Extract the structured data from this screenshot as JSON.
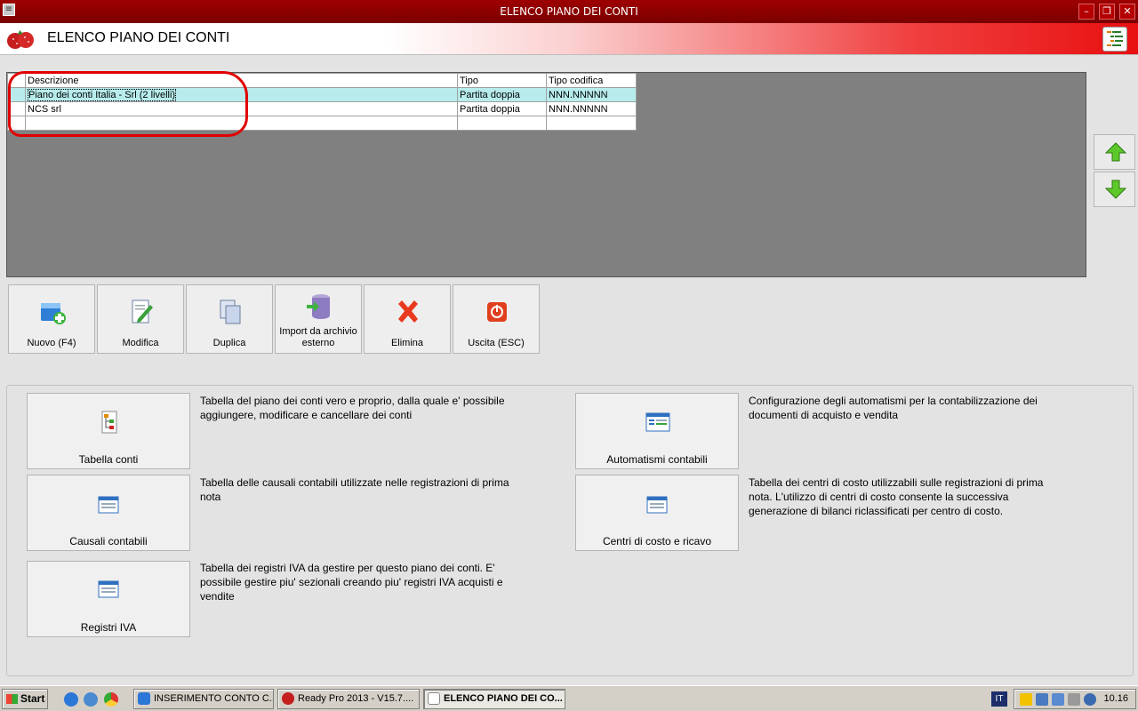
{
  "window": {
    "title": "ELENCO PIANO DEI CONTI"
  },
  "header": {
    "title": "ELENCO PIANO DEI CONTI"
  },
  "grid": {
    "columns": [
      "Descrizione",
      "Tipo",
      "Tipo codifica"
    ],
    "rows": [
      {
        "descrizione": "Piano dei conti Italia - Srl (2 livelli)",
        "tipo": "Partita doppia",
        "codifica": "NNN.NNNNN",
        "selected": true
      },
      {
        "descrizione": "NCS srl",
        "tipo": "Partita doppia",
        "codifica": "NNN.NNNNN",
        "selected": false
      }
    ]
  },
  "toolbar": {
    "nuovo": "Nuovo (F4)",
    "modifica": "Modifica",
    "duplica": "Duplica",
    "import_line1": "Import da archivio",
    "import_line2": "esterno",
    "elimina": "Elimina",
    "uscita": "Uscita (ESC)"
  },
  "options": {
    "tabella_conti": {
      "label": "Tabella conti",
      "desc": "Tabella del piano dei conti vero e proprio, dalla quale e' possibile aggiungere, modificare e cancellare dei conti"
    },
    "causali": {
      "label": "Causali contabili",
      "desc": "Tabella delle causali contabili utilizzate nelle registrazioni di prima nota"
    },
    "registri_iva": {
      "label": "Registri IVA",
      "desc": "Tabella dei registri IVA da gestire per questo piano dei conti. E' possibile gestire piu' sezionali creando piu' registri IVA acquisti e vendite"
    },
    "automatismi": {
      "label": "Automatismi contabili",
      "desc": "Configurazione degli automatismi per la contabilizzazione dei documenti di acquisto e vendita"
    },
    "centri_costo": {
      "label": "Centri di costo e ricavo",
      "desc": "Tabella dei centri di costo utilizzabili sulle registrazioni di prima nota. L'utilizzo di centri di costo consente la successiva generazione di bilanci riclassificati per centro di costo."
    }
  },
  "taskbar": {
    "start": "Start",
    "tasks": [
      "INSERIMENTO CONTO C...",
      "Ready Pro 2013 - V15.7....",
      "ELENCO PIANO DEI CO..."
    ],
    "lang": "IT",
    "clock": "10.16"
  },
  "colors": {
    "titlebar": "#8b0000",
    "selection": "#b8ecec",
    "grid_bg": "#808080",
    "annotation": "#e00000"
  }
}
